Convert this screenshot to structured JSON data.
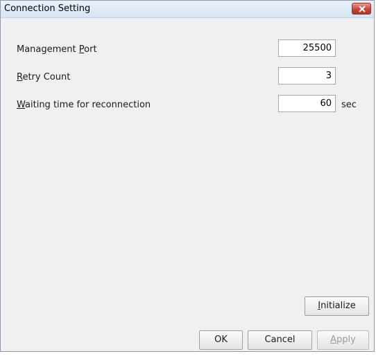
{
  "window": {
    "title": "Connection Setting",
    "close_icon": "close-icon"
  },
  "fields": [
    {
      "label_pre": "Management ",
      "mnemonic": "P",
      "label_post": "ort",
      "value": "25500",
      "unit": ""
    },
    {
      "label_pre": "",
      "mnemonic": "R",
      "label_post": "etry Count",
      "value": "3",
      "unit": ""
    },
    {
      "label_pre": "",
      "mnemonic": "W",
      "label_post": "aiting time for reconnection",
      "value": "60",
      "unit": "sec"
    }
  ],
  "buttons": {
    "initialize": {
      "mnemonic": "I",
      "rest": "nitialize"
    },
    "ok": "OK",
    "cancel": "Cancel",
    "apply": {
      "mnemonic": "A",
      "rest": "pply"
    }
  }
}
